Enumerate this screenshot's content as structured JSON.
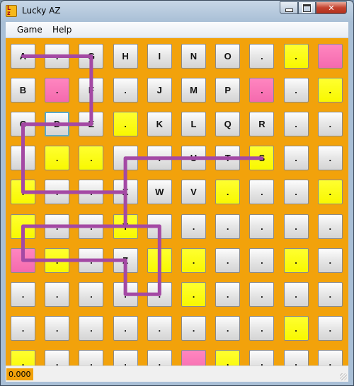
{
  "window": {
    "title": "Lucky AZ"
  },
  "menu": {
    "items": [
      "Game",
      "Help"
    ]
  },
  "status": {
    "score": "0.000"
  },
  "colors": {
    "board": "#f2a20b",
    "yellow": "#ffff00",
    "pink": "#f870b4",
    "path": "#a449a4"
  },
  "board": {
    "rows": [
      [
        {
          "t": "A",
          "c": "g"
        },
        {
          "t": ".",
          "c": "g"
        },
        {
          "t": "G",
          "c": "g"
        },
        {
          "t": "H",
          "c": "g"
        },
        {
          "t": "I",
          "c": "g"
        },
        {
          "t": "N",
          "c": "g"
        },
        {
          "t": "O",
          "c": "g"
        },
        {
          "t": ".",
          "c": "g"
        },
        {
          "t": ".",
          "c": "y"
        },
        {
          "t": "",
          "c": "p"
        }
      ],
      [
        {
          "t": "B",
          "c": "g"
        },
        {
          "t": ".",
          "c": "p"
        },
        {
          "t": "F",
          "c": "g"
        },
        {
          "t": ".",
          "c": "g"
        },
        {
          "t": "J",
          "c": "g"
        },
        {
          "t": "M",
          "c": "g"
        },
        {
          "t": "P",
          "c": "g"
        },
        {
          "t": ".",
          "c": "p"
        },
        {
          "t": ".",
          "c": "g"
        },
        {
          "t": ".",
          "c": "y"
        }
      ],
      [
        {
          "t": "C",
          "c": "g"
        },
        {
          "t": "D",
          "c": "g",
          "f": true
        },
        {
          "t": "E",
          "c": "g"
        },
        {
          "t": ".",
          "c": "y"
        },
        {
          "t": "K",
          "c": "g"
        },
        {
          "t": "L",
          "c": "g"
        },
        {
          "t": "Q",
          "c": "g"
        },
        {
          "t": "R",
          "c": "g"
        },
        {
          "t": ".",
          "c": "g"
        },
        {
          "t": ".",
          "c": "g"
        }
      ],
      [
        {
          "t": ".",
          "c": "g"
        },
        {
          "t": ".",
          "c": "y"
        },
        {
          "t": ".",
          "c": "y"
        },
        {
          "t": ".",
          "c": "g"
        },
        {
          "t": ".",
          "c": "g"
        },
        {
          "t": "U",
          "c": "g"
        },
        {
          "t": "T",
          "c": "g"
        },
        {
          "t": "S",
          "c": "y"
        },
        {
          "t": ".",
          "c": "g"
        },
        {
          "t": ".",
          "c": "g"
        }
      ],
      [
        {
          "t": ".",
          "c": "y"
        },
        {
          "t": ".",
          "c": "g"
        },
        {
          "t": ".",
          "c": "g"
        },
        {
          "t": "X",
          "c": "g"
        },
        {
          "t": "W",
          "c": "g"
        },
        {
          "t": "V",
          "c": "g"
        },
        {
          "t": ".",
          "c": "y"
        },
        {
          "t": ".",
          "c": "g"
        },
        {
          "t": ".",
          "c": "g"
        },
        {
          "t": ".",
          "c": "y"
        }
      ],
      [
        {
          "t": ".",
          "c": "y"
        },
        {
          "t": ".",
          "c": "g"
        },
        {
          "t": ".",
          "c": "g"
        },
        {
          "t": "Y",
          "c": "y"
        },
        {
          "t": ".",
          "c": "g"
        },
        {
          "t": ".",
          "c": "g"
        },
        {
          "t": ".",
          "c": "g"
        },
        {
          "t": ".",
          "c": "g"
        },
        {
          "t": ".",
          "c": "g"
        },
        {
          "t": ".",
          "c": "g"
        }
      ],
      [
        {
          "t": "",
          "c": "p"
        },
        {
          "t": ".",
          "c": "y"
        },
        {
          "t": ".",
          "c": "g"
        },
        {
          "t": "Z",
          "c": "g"
        },
        {
          "t": ".",
          "c": "y"
        },
        {
          "t": ".",
          "c": "y"
        },
        {
          "t": ".",
          "c": "g"
        },
        {
          "t": ".",
          "c": "g"
        },
        {
          "t": ".",
          "c": "y"
        },
        {
          "t": ".",
          "c": "g"
        }
      ],
      [
        {
          "t": ".",
          "c": "g"
        },
        {
          "t": ".",
          "c": "g"
        },
        {
          "t": ".",
          "c": "g"
        },
        {
          "t": ".",
          "c": "g"
        },
        {
          "t": ".",
          "c": "g"
        },
        {
          "t": ".",
          "c": "y"
        },
        {
          "t": ".",
          "c": "g"
        },
        {
          "t": ".",
          "c": "g"
        },
        {
          "t": ".",
          "c": "g"
        },
        {
          "t": ".",
          "c": "g"
        }
      ],
      [
        {
          "t": ".",
          "c": "g"
        },
        {
          "t": ".",
          "c": "g"
        },
        {
          "t": ".",
          "c": "g"
        },
        {
          "t": ".",
          "c": "g"
        },
        {
          "t": ".",
          "c": "g"
        },
        {
          "t": ".",
          "c": "g"
        },
        {
          "t": ".",
          "c": "g"
        },
        {
          "t": ".",
          "c": "g"
        },
        {
          "t": ".",
          "c": "y"
        },
        {
          "t": ".",
          "c": "g"
        }
      ],
      [
        {
          "t": ".",
          "c": "y"
        },
        {
          "t": ".",
          "c": "g"
        },
        {
          "t": ".",
          "c": "g"
        },
        {
          "t": ".",
          "c": "g"
        },
        {
          "t": ".",
          "c": "g"
        },
        {
          "t": "",
          "c": "p"
        },
        {
          "t": ".",
          "c": "y"
        },
        {
          "t": ".",
          "c": "g"
        },
        {
          "t": ".",
          "c": "g"
        },
        {
          "t": ".",
          "c": "g"
        }
      ]
    ],
    "path": [
      [
        0,
        0
      ],
      [
        2,
        0
      ],
      [
        2,
        2
      ],
      [
        0,
        2
      ],
      [
        0,
        4
      ],
      [
        3,
        4
      ],
      [
        3,
        5
      ],
      [
        0,
        5
      ],
      [
        0,
        6
      ],
      [
        3,
        6
      ],
      [
        3,
        7
      ],
      [
        4,
        7
      ],
      [
        4,
        5
      ],
      [
        3,
        5
      ],
      [
        3,
        3
      ],
      [
        4,
        3
      ],
      [
        7,
        3
      ]
    ]
  }
}
